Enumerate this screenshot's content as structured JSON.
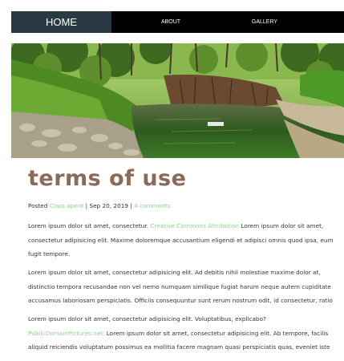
{
  "nav": {
    "items": [
      {
        "label": "HOME"
      },
      {
        "label": "ABOUT"
      },
      {
        "label": "GALLERY"
      }
    ]
  },
  "hero": {
    "icon": "stream-photo"
  },
  "page": {
    "title": "terms of use",
    "meta": {
      "posted": "Posted",
      "author": "Class apent",
      "sep1": " | ",
      "date": "Sep 20, 2019",
      "sep2": " | ",
      "comments": "4 comments"
    }
  },
  "paragraphs": {
    "p1": {
      "l1_pre": "Lorem ipsum dolor sit amet, consectetur. ",
      "l1_link": "Creative Commons Attribution",
      "l1_post": " Lorem ipsum dolor sit amet,",
      "l2": "consectetur adipisicing elit. Maxime doloremque accusantium eligendi et adipisci omnis quod ipsa, eum",
      "l3": "fugit tempore."
    },
    "p2": {
      "l1": "Lorem ipsum dolor sit amet, consectetur adipisicing elit. Ad debitis nihil molestiae maxime dolor at,",
      "l2": "distinctio tempora recusandae non vel nemo numquam similique fugiat harum neque autem cupiditate",
      "l3": "accusamus laboriosam perspiciatis. Officiis consequuntur sunt rerum nostrum odit, id consectetur, ratio"
    },
    "p3": {
      "l1": "Lorem ipsum dolor sit amet, consectetur adipisicing elit. Voluptatibus, explicabo?",
      "l2_link": "PublicDomainPictures.net.",
      "l2_post": " Lorem ipsum dolor sit amet, consectetur adipisicing elit. Ab tempore, facilis",
      "l3": "aliquid reiciendis voluptatum possimus ea mollitia facere magnam quasi perspiciatis quas, eveniet iste"
    }
  },
  "colors": {
    "nav_bg": "#000000",
    "nav_active": "#2a3a44",
    "title": "#8a6a58",
    "link": "#8cd48c"
  }
}
